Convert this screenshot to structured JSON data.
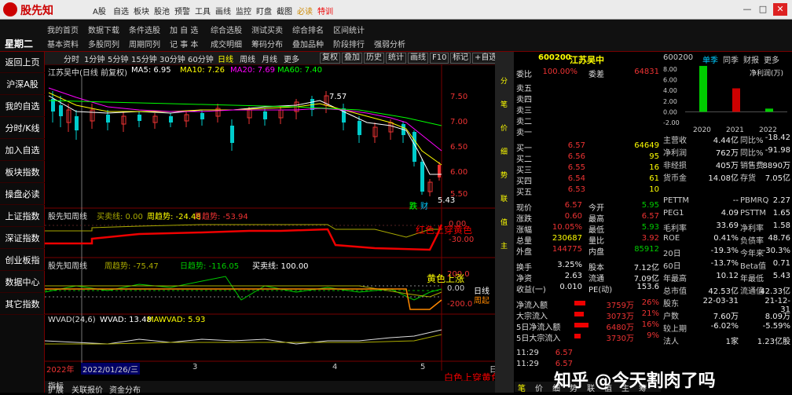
{
  "app": {
    "name": "股先知",
    "menu": [
      "A股",
      "自选",
      "板块",
      "股池",
      "预警",
      "工具",
      "画线",
      "监控",
      "盯盘",
      "截图",
      "必读",
      "特训"
    ],
    "win": [
      "—",
      "□",
      "✕"
    ]
  },
  "toolbar": {
    "weekday": "星期二",
    "row1": [
      "我的首页",
      "数据下载",
      "条件选股",
      "加 自 选",
      "综合选股",
      "测试买卖",
      "综合排名",
      "区间统计"
    ],
    "row2": [
      "基本资料",
      "多股同列",
      "周期同列",
      "记 事 本",
      "成交明细",
      "筹码分布",
      "叠加品种",
      "阶段排行",
      "强弱分析"
    ]
  },
  "sidebar": [
    "返回上页",
    "沪深A股",
    "我的自选",
    "分时/K线",
    "加入自选",
    "板块指数",
    "操盘必读",
    "上证指数",
    "深证指数",
    "创业板指",
    "数据中心",
    "其它指数"
  ],
  "chart_tabs": {
    "periods": [
      "分时",
      "1分钟",
      "5分钟",
      "15分钟",
      "30分钟",
      "60分钟",
      "日线",
      "周线",
      "月线",
      "更多"
    ],
    "active": "日线",
    "buttons": [
      "复权",
      "叠加",
      "历史",
      "统计",
      "画线",
      "F10",
      "标记",
      "+自选"
    ]
  },
  "kline": {
    "title": "江苏吴中(日线 前复权)",
    "ma": [
      "MA5: 6.95",
      "MA10: 7.26",
      "MA20: 7.69",
      "MA60: 7.40"
    ],
    "ma_colors": [
      "#fff",
      "#ff0",
      "#f0f",
      "#0f0"
    ],
    "prices": [
      "7.50",
      "7.00",
      "6.50",
      "6.00",
      "5.50"
    ],
    "high": "7.57",
    "low": "5.43",
    "die": "跌",
    "cai": "财"
  },
  "ind1": {
    "name": "股先知周线",
    "s1": "买卖线: 0.00",
    "s2": "周趋势: -24.48",
    "s3": "月趋势: -53.94",
    "scale": [
      "0.00",
      "-30.00"
    ],
    "note": "红色上穿黄色"
  },
  "ind2": {
    "name": "股先知周线",
    "s1": "周趋势: -75.47",
    "s2": "日趋势: -116.05",
    "s3": "买卖线: 100.00",
    "scale": [
      "200.0",
      "0.00",
      "-200.0"
    ],
    "note": "黄色上涨",
    "r1": "日线",
    "r2": "周起"
  },
  "ind3": {
    "name": "WVAD(24,6)",
    "s1": "WVAD: 13.48",
    "s2": "MAWVAD: 5.93",
    "note": "白色上穿黄色"
  },
  "xaxis": {
    "year": "2022年",
    "date": "2022/01/26/三",
    "m1": "3",
    "m2": "4",
    "m3": "5",
    "period": "日线"
  },
  "bottom_tabs": [
    "指标",
    "扩展",
    "关联报价",
    "资金分布"
  ],
  "quote": {
    "code": "600200",
    "name": "江苏吴中",
    "wb": {
      "l1": "委比",
      "v1": "100.00%",
      "l2": "委差",
      "v2": "64831"
    },
    "asks": [
      [
        "卖五",
        "",
        ""
      ],
      [
        "卖四",
        "",
        ""
      ],
      [
        "卖三",
        "",
        ""
      ],
      [
        "卖二",
        "",
        ""
      ],
      [
        "卖一",
        "",
        ""
      ]
    ],
    "bids": [
      [
        "买一",
        "6.57",
        "64649"
      ],
      [
        "买二",
        "6.56",
        "95"
      ],
      [
        "买三",
        "6.55",
        "16"
      ],
      [
        "买四",
        "6.54",
        "61"
      ],
      [
        "买五",
        "6.53",
        "10"
      ]
    ],
    "stats": [
      [
        "现价",
        "6.57",
        "今开",
        "5.95"
      ],
      [
        "涨跌",
        "0.60",
        "最高",
        "6.57"
      ],
      [
        "涨幅",
        "10.05%",
        "最低",
        "5.93"
      ],
      [
        "总量",
        "230687",
        "量比",
        "3.92"
      ],
      [
        "外盘",
        "144775",
        "内盘",
        "85912"
      ]
    ],
    "stats2": [
      [
        "换手",
        "3.25%",
        "股本",
        "7.12亿"
      ],
      [
        "净资",
        "2.63",
        "流通",
        "7.09亿"
      ],
      [
        "收益(一)",
        "0.010",
        "PE(动)",
        "153.6"
      ]
    ],
    "flows": [
      [
        "净流入额",
        "3759万",
        "26%"
      ],
      [
        "大宗流入",
        "3073万",
        "21%"
      ],
      [
        "5日净流入额",
        "6480万",
        "16%"
      ],
      [
        "5日大宗流入",
        "3730万",
        "9%"
      ]
    ],
    "ticks": [
      [
        "11:29",
        "6.57",
        ""
      ],
      [
        "11:29",
        "6.57",
        ""
      ]
    ],
    "scroll": [
      "分",
      "笔",
      "价",
      "细",
      "势",
      "联",
      "值",
      "主"
    ],
    "btabs": [
      "笔",
      "价",
      "细",
      "势",
      "联",
      "值",
      "主",
      "筹"
    ]
  },
  "finance": {
    "code": "600200",
    "tabs": [
      "单季",
      "同季",
      "财报",
      "更多"
    ],
    "chart_title": "净利润(万)",
    "bars": [
      {
        "year": "2020",
        "value": 8.6,
        "color": "#0c0"
      },
      {
        "year": "2021",
        "value": 4.4,
        "color": "#c00"
      },
      {
        "year": "2022",
        "value": 0.6,
        "color": "#0c0"
      }
    ],
    "yticks": [
      "8.00",
      "6.00",
      "4.00",
      "2.00",
      "0.00",
      "-2.00"
    ],
    "rows": [
      [
        "主营收",
        "4.44亿",
        "同比%",
        "-18.42"
      ],
      [
        "净利润",
        "762万",
        "同比%",
        "-91.98"
      ],
      [
        "非经损",
        "405万",
        "销售费",
        "8890万"
      ],
      [
        "货币金",
        "14.08亿",
        "存货",
        "7.05亿"
      ],
      [
        "",
        "",
        "",
        ""
      ],
      [
        "PETTM",
        "--",
        "PBMRQ",
        "2.27"
      ],
      [
        "PEG1",
        "4.09",
        "PSTTM",
        "1.65"
      ],
      [
        "毛利率",
        "33.69",
        "净利率",
        "1.58"
      ],
      [
        "ROE",
        "0.41%",
        "负债率",
        "48.76"
      ],
      [
        "20日",
        "-19.3%",
        "今年来",
        "-30.3%"
      ],
      [
        "60日",
        "-13.7%",
        "Beta值",
        "0.71"
      ],
      [
        "年最高",
        "10.12",
        "年最低",
        "5.43"
      ],
      [
        "总市值",
        "42.53亿",
        "流通值",
        "42.33亿"
      ],
      [
        "股东",
        "22-03-31",
        "",
        "21-12-31"
      ],
      [
        "户数",
        "7.60万",
        "",
        "8.09万"
      ],
      [
        "较上期",
        "-6.02%",
        "",
        "-5.59%"
      ],
      [
        "法人",
        "1家",
        "",
        "1.23亿股"
      ]
    ]
  },
  "watermark": "知乎 @今天割肉了吗"
}
